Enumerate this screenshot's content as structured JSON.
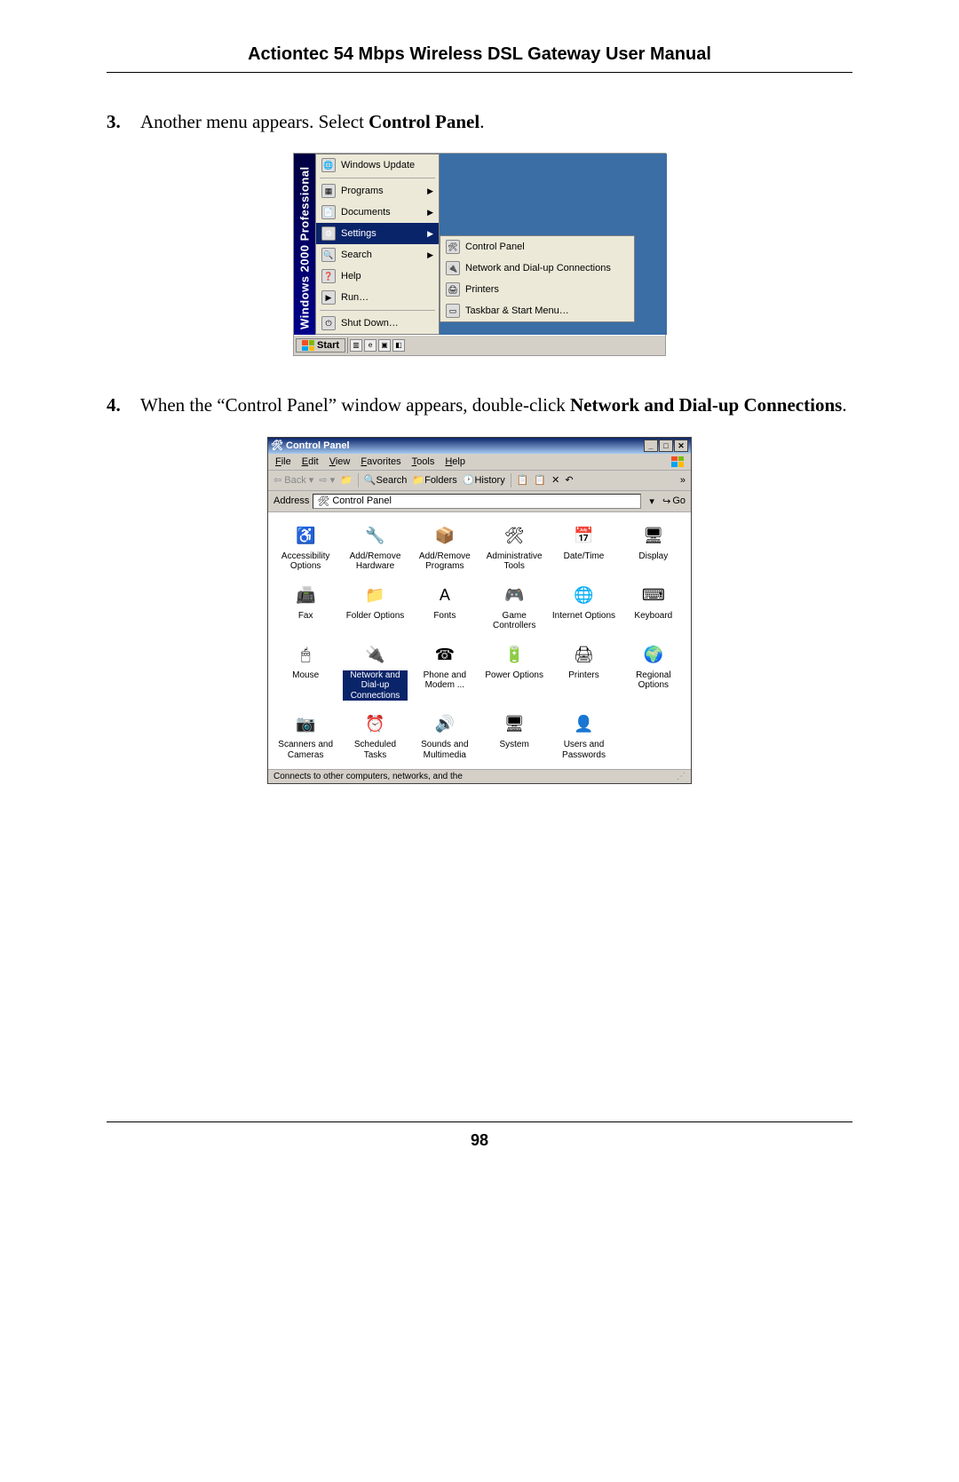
{
  "header": {
    "title": "Actiontec 54 Mbps Wireless DSL Gateway User Manual"
  },
  "steps": {
    "s3": {
      "num": "3.",
      "pre": "Another menu appears. Select ",
      "bold": "Control Panel",
      "post": "."
    },
    "s4": {
      "num": "4.",
      "pre": "When the “Control Panel” window appears, double-click ",
      "bold": "Network and Dial-up Connections",
      "post": "."
    }
  },
  "startmenu": {
    "banner": "Windows 2000 Professional",
    "items": [
      "Windows Update",
      "Programs",
      "Documents",
      "Settings",
      "Search",
      "Help",
      "Run…",
      "Shut Down…"
    ],
    "submenu": [
      "Control Panel",
      "Network and Dial-up Connections",
      "Printers",
      "Taskbar & Start Menu…"
    ],
    "taskbar": {
      "start": "Start"
    }
  },
  "cp": {
    "title": "Control Panel",
    "menu": [
      "File",
      "Edit",
      "View",
      "Favorites",
      "Tools",
      "Help"
    ],
    "toolbar": {
      "back": "Back",
      "search": "Search",
      "folders": "Folders",
      "history": "History"
    },
    "address": {
      "label": "Address",
      "value": "Control Panel",
      "go": "Go"
    },
    "items": [
      {
        "label": "Accessibility Options",
        "icon": "♿"
      },
      {
        "label": "Add/Remove Hardware",
        "icon": "🔧"
      },
      {
        "label": "Add/Remove Programs",
        "icon": "📦"
      },
      {
        "label": "Administrative Tools",
        "icon": "🛠"
      },
      {
        "label": "Date/Time",
        "icon": "📅"
      },
      {
        "label": "Display",
        "icon": "🖥"
      },
      {
        "label": "Fax",
        "icon": "📠"
      },
      {
        "label": "Folder Options",
        "icon": "📁"
      },
      {
        "label": "Fonts",
        "icon": "A"
      },
      {
        "label": "Game Controllers",
        "icon": "🎮"
      },
      {
        "label": "Internet Options",
        "icon": "🌐"
      },
      {
        "label": "Keyboard",
        "icon": "⌨"
      },
      {
        "label": "Mouse",
        "icon": "🖱"
      },
      {
        "label": "Network and Dial-up Connections",
        "icon": "🔌",
        "sel": true
      },
      {
        "label": "Phone and Modem ...",
        "icon": "☎"
      },
      {
        "label": "Power Options",
        "icon": "🔋"
      },
      {
        "label": "Printers",
        "icon": "🖨"
      },
      {
        "label": "Regional Options",
        "icon": "🌍"
      },
      {
        "label": "Scanners and Cameras",
        "icon": "📷"
      },
      {
        "label": "Scheduled Tasks",
        "icon": "⏰"
      },
      {
        "label": "Sounds and Multimedia",
        "icon": "🔊"
      },
      {
        "label": "System",
        "icon": "🖥"
      },
      {
        "label": "Users and Passwords",
        "icon": "👤"
      }
    ],
    "status": "Connects to other computers, networks, and the"
  },
  "footer": {
    "page": "98"
  }
}
